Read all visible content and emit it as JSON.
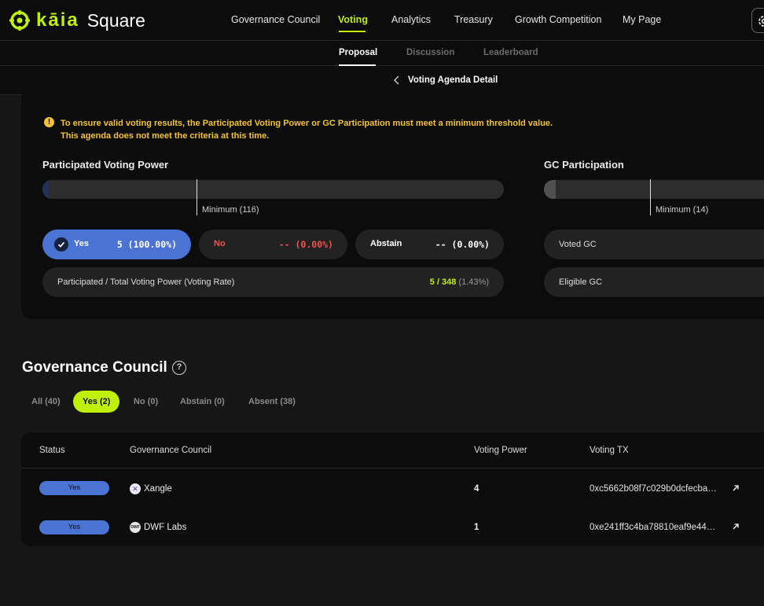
{
  "header": {
    "logo_kaia": "kāia",
    "logo_square": "Square",
    "nav": [
      "Governance Council",
      "Voting",
      "Analytics",
      "Treasury",
      "Growth Competition",
      "My Page"
    ],
    "active_nav": "Voting",
    "accent_color": "#bff009",
    "settings_icon": "gear-icon"
  },
  "subnav": {
    "tabs": [
      "Proposal",
      "Discussion",
      "Leaderboard"
    ],
    "active_tab": "Proposal"
  },
  "detail": {
    "back_icon": "chevron-left-icon",
    "title": "Voting Agenda Detail"
  },
  "notice": {
    "line1": "To ensure valid voting results, the Participated Voting Power or GC Participation must meet a minimum threshold value.",
    "line2": "This agenda does not meet the criteria at this time.",
    "icon": "info-icon",
    "color": "#f4c430"
  },
  "voting_power": {
    "label": "Participated Voting Power",
    "fill_fraction": 0.0143,
    "minimum_fraction": 0.333,
    "minimum_label": "Minimum (116)",
    "options": [
      {
        "label": "Yes",
        "value": "5 (100.00%)",
        "icon": "check-icon"
      },
      {
        "label": "No",
        "value": "-- (0.00%)"
      },
      {
        "label": "Abstain",
        "value": "-- (0.00%)"
      }
    ],
    "rate_label": "Participated / Total Voting Power (Voting Rate)",
    "rate_main": "5 / 348",
    "rate_pct": "(1.43%)"
  },
  "gc_participation": {
    "label": "GC Participation",
    "fill_fraction": 0.05,
    "minimum_label": "Minimum (14)",
    "voted_label": "Voted GC",
    "eligible_label": "Eligible GC"
  },
  "council": {
    "title": "Governance Council",
    "help_icon": "question-icon",
    "filters": [
      "All (40)",
      "Yes (2)",
      "No (0)",
      "Abstain (0)",
      "Absent (38)"
    ],
    "active_filter": "Yes (2)",
    "columns": [
      "Status",
      "Governance Council",
      "Voting Power",
      "Voting TX"
    ],
    "rows": [
      {
        "status": "Yes",
        "name": "Xangle",
        "voting_power": "4",
        "tx": "0xc5662b08f7c029b0dcfecba…"
      },
      {
        "status": "Yes",
        "name": "DWF Labs",
        "voting_power": "1",
        "tx": "0xe241ff3c4ba78810eaf9e44…"
      }
    ]
  }
}
